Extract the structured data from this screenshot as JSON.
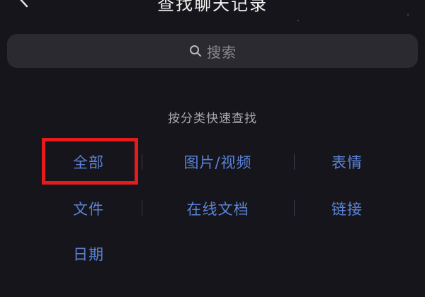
{
  "header": {
    "title": "查找聊天记录"
  },
  "search": {
    "placeholder": "搜索"
  },
  "section_label": "按分类快速查找",
  "categories": [
    {
      "label": "全部"
    },
    {
      "label": "图片/视频"
    },
    {
      "label": "表情"
    },
    {
      "label": "文件"
    },
    {
      "label": "在线文档"
    },
    {
      "label": "链接"
    },
    {
      "label": "日期"
    }
  ],
  "colors": {
    "background": "#15151b",
    "search_bg": "#2a2a30",
    "category_text": "#5b82d6",
    "highlight": "#e41c1c"
  }
}
